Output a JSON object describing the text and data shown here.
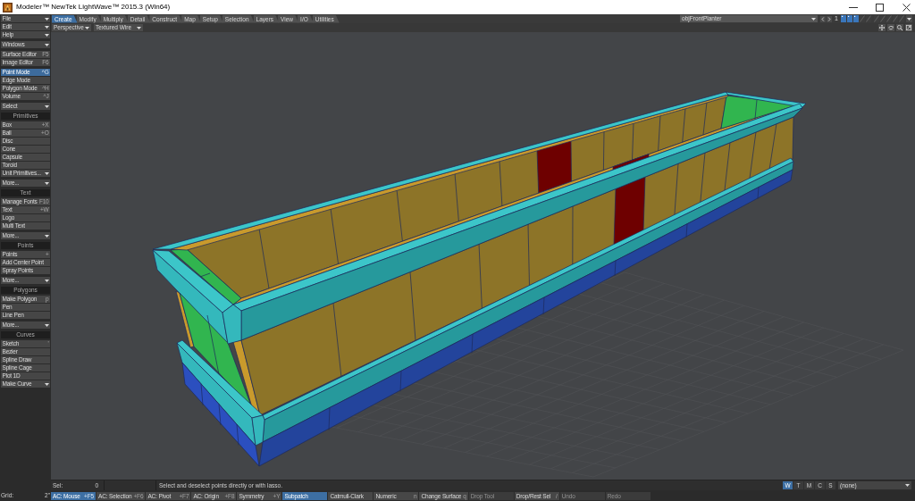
{
  "window": {
    "title": "Modeler™ NewTek LightWave™ 2015.3 (Win64)"
  },
  "menu_tabs": [
    {
      "label": "Create",
      "selected": true
    },
    {
      "label": "Modify",
      "selected": false
    },
    {
      "label": "Multiply",
      "selected": false
    },
    {
      "label": "Detail",
      "selected": false
    },
    {
      "label": "Construct",
      "selected": false
    },
    {
      "label": "Map",
      "selected": false
    },
    {
      "label": "Setup",
      "selected": false
    },
    {
      "label": "Selection",
      "selected": false
    },
    {
      "label": "Layers",
      "selected": false
    },
    {
      "label": "View",
      "selected": false
    },
    {
      "label": "I/O",
      "selected": false
    },
    {
      "label": "Utilities",
      "selected": false
    }
  ],
  "object_selector": {
    "value": "objFrontPlanter"
  },
  "layer_bank": {
    "number": "1"
  },
  "layers": [
    {
      "selected": true
    },
    {
      "selected": true
    },
    {
      "selected": true
    },
    {
      "selected": false
    },
    {
      "selected": false
    },
    {
      "selected": false
    },
    {
      "selected": false
    },
    {
      "selected": false
    },
    {
      "selected": false
    },
    {
      "selected": false
    }
  ],
  "viewport": {
    "view_type": "Perspective",
    "render_style": "Textured Wire"
  },
  "sidebar": [
    {
      "items": [
        {
          "label": "File",
          "kind": "dropdown"
        },
        {
          "label": "Edit",
          "kind": "dropdown"
        },
        {
          "label": "Help",
          "kind": "dropdown"
        }
      ]
    },
    {
      "items": [
        {
          "label": "Windows",
          "kind": "dropdown"
        }
      ]
    },
    {
      "items": [
        {
          "label": "Surface Editor",
          "shortcut": "F5",
          "kind": "button"
        },
        {
          "label": "Image Editor",
          "shortcut": "F6",
          "kind": "button"
        }
      ]
    },
    {
      "items": [
        {
          "label": "Point Mode",
          "shortcut": "^G",
          "kind": "button",
          "selected": true
        },
        {
          "label": "Edge Mode",
          "kind": "button",
          "selected": false
        },
        {
          "label": "Polygon Mode",
          "shortcut": "^H",
          "kind": "button",
          "selected": false
        },
        {
          "label": "Volume",
          "shortcut": "^J",
          "kind": "button",
          "selected": false
        }
      ]
    },
    {
      "items": [
        {
          "label": "Select",
          "kind": "dropdown"
        }
      ]
    },
    {
      "header": "Primitives",
      "items": [
        {
          "label": "Box",
          "shortcut": "+X",
          "kind": "button"
        },
        {
          "label": "Ball",
          "shortcut": "+O",
          "kind": "button"
        },
        {
          "label": "Disc",
          "kind": "button"
        },
        {
          "label": "Cone",
          "kind": "button"
        },
        {
          "label": "Capsule",
          "kind": "button"
        },
        {
          "label": "Toroid",
          "kind": "button"
        },
        {
          "label": "Unit Primitives...",
          "kind": "dropdown"
        }
      ]
    },
    {
      "items": [
        {
          "label": "More...",
          "kind": "dropdown"
        }
      ]
    },
    {
      "header": "Text",
      "items": [
        {
          "label": "Manage Fonts",
          "shortcut": "F10",
          "kind": "button"
        },
        {
          "label": "Text",
          "shortcut": "+W",
          "kind": "button"
        },
        {
          "label": "Logo",
          "kind": "button"
        },
        {
          "label": "Multi Text",
          "kind": "button"
        }
      ]
    },
    {
      "items": [
        {
          "label": "More...",
          "kind": "dropdown"
        }
      ]
    },
    {
      "header": "Points",
      "items": [
        {
          "label": "Points",
          "shortcut": "+",
          "kind": "button"
        },
        {
          "label": "Add Center Point",
          "kind": "button"
        },
        {
          "label": "Spray Points",
          "kind": "button"
        }
      ]
    },
    {
      "items": [
        {
          "label": "More...",
          "kind": "dropdown"
        }
      ]
    },
    {
      "header": "Polygons",
      "items": [
        {
          "label": "Make Polygon",
          "shortcut": "p",
          "kind": "button"
        },
        {
          "label": "Pen",
          "kind": "button"
        },
        {
          "label": "Line Pen",
          "kind": "button"
        }
      ]
    },
    {
      "items": [
        {
          "label": "More...",
          "kind": "dropdown"
        }
      ]
    },
    {
      "header": "Curves",
      "items": [
        {
          "label": "Sketch",
          "shortcut": "'",
          "kind": "button"
        },
        {
          "label": "Bezier",
          "kind": "button"
        },
        {
          "label": "Spline Draw",
          "kind": "button"
        },
        {
          "label": "Spline Cage",
          "kind": "button"
        },
        {
          "label": "Plot 1D",
          "kind": "button"
        },
        {
          "label": "Make Curve",
          "kind": "dropdown"
        }
      ]
    }
  ],
  "status_bar": {
    "sel_label": "Sel:",
    "sel_value": "0",
    "hint": "Select and deselect points directly or with lasso.",
    "map_types": [
      {
        "label": "W",
        "selected": true
      },
      {
        "label": "T",
        "selected": false
      },
      {
        "label": "M",
        "selected": false
      },
      {
        "label": "C",
        "selected": false
      },
      {
        "label": "S",
        "selected": false
      }
    ],
    "map_value": "(none)"
  },
  "grid": {
    "label": "Grid:",
    "value": "2\""
  },
  "bottom_buttons": [
    {
      "label": "AC: Mouse",
      "shortcut": "+F5",
      "selected": true,
      "disabled": false
    },
    {
      "label": "AC: Selection",
      "shortcut": "+F6",
      "selected": false,
      "disabled": false
    },
    {
      "label": "AC: Pivot",
      "shortcut": "+F7",
      "selected": false,
      "disabled": false
    },
    {
      "label": "AC: Origin",
      "shortcut": "+F8",
      "selected": false,
      "disabled": false
    },
    {
      "label": "Symmetry",
      "shortcut": "+Y",
      "selected": false,
      "disabled": false
    },
    {
      "label": "Subpatch",
      "selected": true,
      "disabled": false
    },
    {
      "label": "Catmull-Clark",
      "selected": false,
      "disabled": false
    },
    {
      "label": "Numeric",
      "shortcut": "n",
      "selected": false,
      "disabled": false
    },
    {
      "label": "Change Surface",
      "shortcut": "q",
      "selected": false,
      "disabled": false
    },
    {
      "label": "Drop Tool",
      "selected": false,
      "disabled": true
    },
    {
      "label": "Drop/Rest Sel",
      "shortcut": "/",
      "selected": false,
      "disabled": false
    },
    {
      "label": "Undo",
      "selected": false,
      "disabled": true
    },
    {
      "label": "Redo",
      "selected": false,
      "disabled": true
    }
  ]
}
